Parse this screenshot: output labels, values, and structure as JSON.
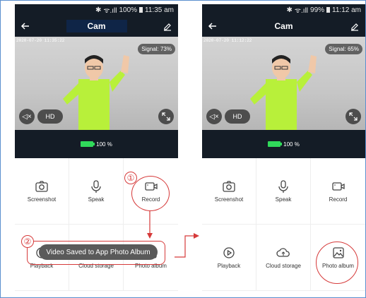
{
  "left": {
    "status": {
      "bt": "✱",
      "signal": "ᯤ.ıll",
      "battery_pct": "100%",
      "time": "11:35 am"
    },
    "title": "Cam",
    "timestamp": "2020-07-20 11:35:22",
    "signal_label": "Signal: 73%",
    "hd_label": "HD",
    "battery_label": "100 %",
    "actions": [
      {
        "label": "Screenshot",
        "icon": "camera-icon"
      },
      {
        "label": "Speak",
        "icon": "microphone-icon"
      },
      {
        "label": "Record",
        "icon": "video-camera-icon"
      },
      {
        "label": "Playback",
        "icon": "playback-icon"
      },
      {
        "label": "Cloud storage",
        "icon": "cloud-icon"
      },
      {
        "label": "Photo album",
        "icon": "image-icon"
      }
    ],
    "toast": "Video Saved to App Photo Album"
  },
  "right": {
    "status": {
      "bt": "✱",
      "signal": "ᯤ.ıll",
      "battery_pct": "99%",
      "time": "11:12 am"
    },
    "title": "Cam",
    "timestamp": "2020-07-20 11:12:22",
    "signal_label": "Signal: 65%",
    "hd_label": "HD",
    "battery_label": "100 %",
    "actions": [
      {
        "label": "Screenshot",
        "icon": "camera-icon"
      },
      {
        "label": "Speak",
        "icon": "microphone-icon"
      },
      {
        "label": "Record",
        "icon": "video-camera-icon"
      },
      {
        "label": "Playback",
        "icon": "playback-icon"
      },
      {
        "label": "Cloud storage",
        "icon": "cloud-icon"
      },
      {
        "label": "Photo album",
        "icon": "image-icon"
      }
    ]
  },
  "annotations": {
    "step1": "①",
    "step2": "②"
  },
  "colors": {
    "dark_bg": "#141c26",
    "accent_red": "#d63a3a",
    "battery_green": "#30d95a",
    "shirt_green": "#b8f03a"
  }
}
